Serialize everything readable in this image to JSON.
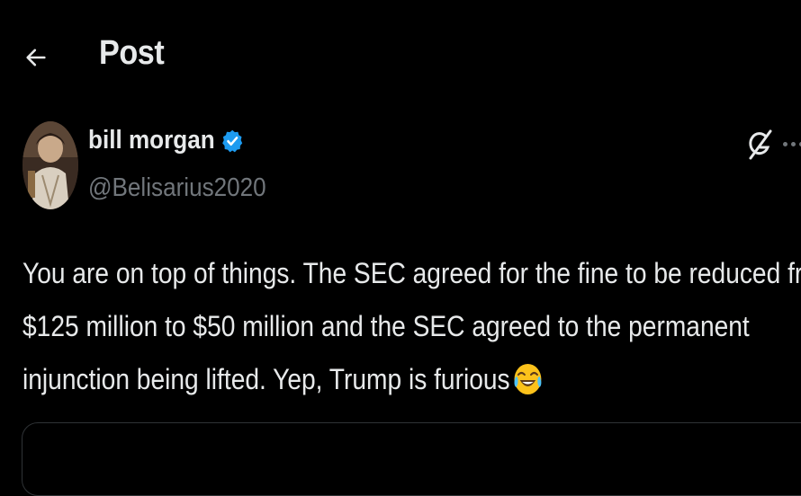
{
  "header": {
    "back_icon": "arrow-left-icon",
    "title": "Post"
  },
  "post": {
    "author": {
      "name": "bill morgan",
      "handle": "@Belisarius2020",
      "verified": true,
      "verified_color": "#1d9bf0",
      "avatar_icon": "avatar-portrait"
    },
    "actions": {
      "grok_icon": "grok-icon",
      "more_icon": "more-icon"
    },
    "text_lines": [
      "You are on top of things. The SEC agreed for the fine to be reduced from",
      "$125 million to $50 million and the SEC agreed to the permanent",
      "injunction being lifted. Yep, Trump is furious"
    ],
    "emoji": "face-with-tears-of-joy-icon"
  },
  "colors": {
    "background": "#000000",
    "text": "#e7e9ea",
    "secondary": "#71767b",
    "border": "#2f3336"
  }
}
